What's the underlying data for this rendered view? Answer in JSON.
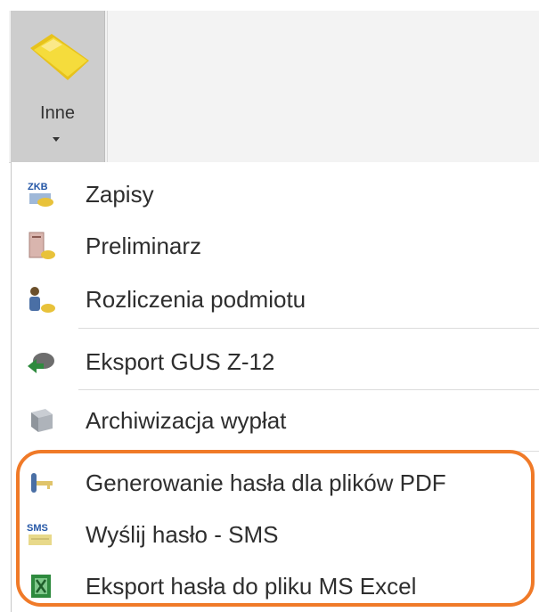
{
  "ribbon": {
    "button_label": "Inne",
    "button_icon": "folder-icon"
  },
  "menu": {
    "items": [
      {
        "label": "Zapisy",
        "icon": "zkb-icon",
        "icon_text": "ZKB"
      },
      {
        "label": "Preliminarz",
        "icon": "document-coins-icon"
      },
      {
        "label": "Rozliczenia podmiotu",
        "icon": "person-coins-icon"
      },
      {
        "label": "Eksport GUS Z-12",
        "icon": "export-arrow-icon"
      },
      {
        "label": "Archiwizacja wypłat",
        "icon": "archive-box-icon"
      },
      {
        "label": "Generowanie hasła dla plików PDF",
        "icon": "key-icon"
      },
      {
        "label": "Wyślij hasło - SMS",
        "icon": "sms-icon",
        "icon_text": "SMS"
      },
      {
        "label": "Eksport hasła do pliku MS Excel",
        "icon": "excel-icon"
      }
    ]
  },
  "colors": {
    "highlight": "#f07a28",
    "ribbon_background": "#f3f3f3",
    "ribbon_button_background": "#cdcdcd",
    "folder_yellow": "#f5dc3c",
    "excel_green": "#2e8a3e"
  }
}
